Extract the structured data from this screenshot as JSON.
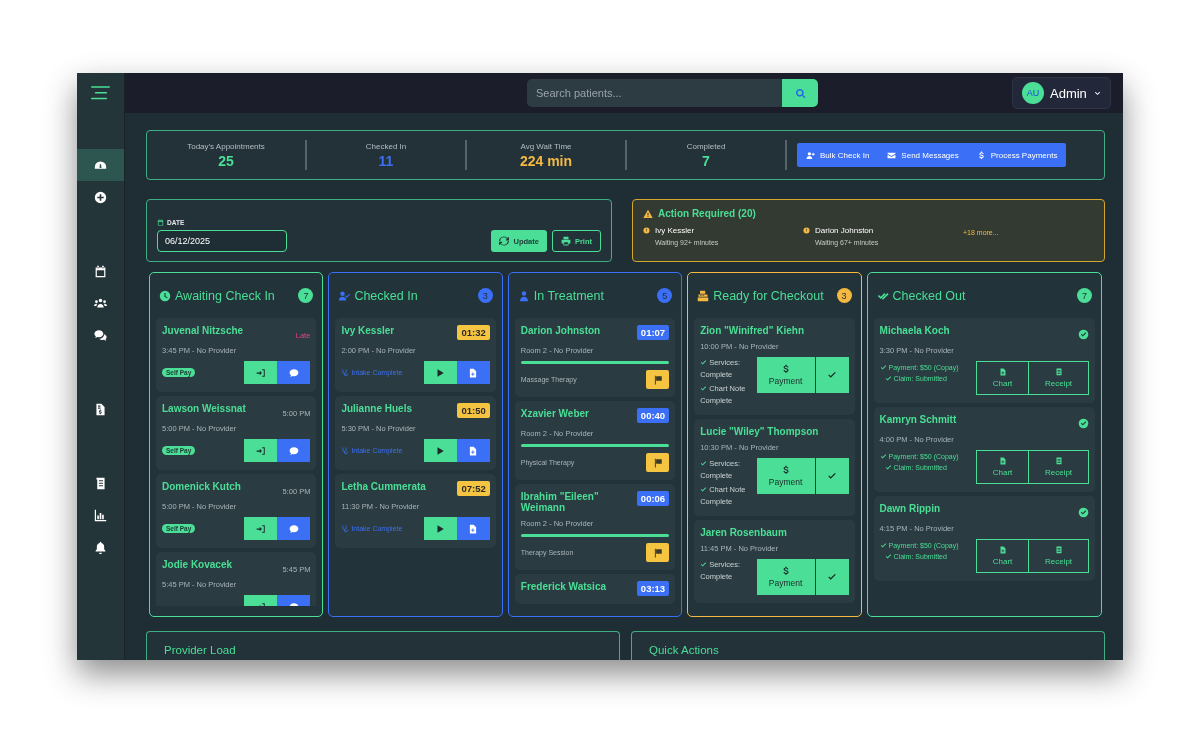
{
  "topbar": {
    "search": {
      "placeholder": "Search patients..."
    },
    "user": {
      "initials": "AU",
      "name": "Admin"
    }
  },
  "sidebar": {
    "groups": [
      [
        {
          "selected": true
        },
        {
          "selected": false
        }
      ],
      [
        {
          "selected": false
        },
        {
          "selected": false
        },
        {
          "selected": false
        }
      ],
      [
        {
          "selected": false
        }
      ],
      [
        {
          "selected": false
        },
        {
          "selected": false
        },
        {
          "selected": false
        }
      ]
    ]
  },
  "stats": [
    {
      "label": "Today's Appointments",
      "value": "25",
      "color": "#4ade96"
    },
    {
      "label": "Checked In",
      "value": "11",
      "color": "#3b6ff5"
    },
    {
      "label": "Avg Wait Time",
      "value": "224 min",
      "color": "#f5b942"
    },
    {
      "label": "Completed",
      "value": "7",
      "color": "#4ade96"
    }
  ],
  "bulk_actions": [
    "Bulk Check In",
    "Send Messages",
    "Process Payments"
  ],
  "date_filter": {
    "label": "DATE",
    "value": "06/12/2025",
    "buttons": [
      "Update",
      "Print"
    ]
  },
  "action_required": {
    "title": "Action Required (20)",
    "items": [
      {
        "name": "Ivy Kessler",
        "detail": "Waiting 92+ minutes"
      },
      {
        "name": "Darion Johnston",
        "detail": "Waiting 67+ minutes"
      }
    ],
    "more": "+18 more..."
  },
  "columns": [
    {
      "kind": "awaiting",
      "title": "Awaiting Check In",
      "count": "7",
      "color": "#4ade96",
      "cards": [
        {
          "name": "Juvenal Nitzsche",
          "note": "Late",
          "late": true,
          "sub": "3:45 PM - No Provider",
          "tag": "Self Pay"
        },
        {
          "name": "Lawson Weissnat",
          "note": "5:00 PM",
          "late": false,
          "sub": "5:00 PM - No Provider",
          "tag": "Self Pay"
        },
        {
          "name": "Domenick Kutch",
          "note": "5:00 PM",
          "late": false,
          "sub": "5:00 PM - No Provider",
          "tag": "Self Pay"
        },
        {
          "name": "Jodie Kovacek",
          "note": "5:45 PM",
          "late": false,
          "sub": "5:45 PM - No Provider"
        }
      ]
    },
    {
      "kind": "checked_in",
      "title": "Checked In",
      "count": "3",
      "color": "#3b6ff5",
      "cards": [
        {
          "name": "Ivy Kessler",
          "timer": "01:32",
          "sub": "2:00 PM - No Provider",
          "status": "Intake Complete"
        },
        {
          "name": "Julianne Huels",
          "timer": "01:50",
          "sub": "5:30 PM - No Provider",
          "status": "Intake Complete"
        },
        {
          "name": "Letha Cummerata",
          "timer": "07:52",
          "sub": "11:30 PM - No Provider",
          "status": "Intake Complete"
        }
      ]
    },
    {
      "kind": "treatment",
      "title": "In Treatment",
      "count": "5",
      "color": "#3b6ff5",
      "cards": [
        {
          "name": "Darion Johnston",
          "timer": "01:07",
          "sub": "Room 2 - No Provider",
          "level": 1,
          "therapy": "Massage Therapy"
        },
        {
          "name": "Xzavier Weber",
          "timer": "00:40",
          "sub": "Room 2 - No Provider",
          "level": 1,
          "therapy": "Physical Therapy"
        },
        {
          "name": "Ibrahim \"Eileen\" Weimann",
          "timer": "00:06",
          "sub": "Room 2 - No Provider",
          "level": 1,
          "therapy": "Therapy Session"
        },
        {
          "name": "Frederick Watsica",
          "timer": "03:13"
        }
      ]
    },
    {
      "kind": "checkout",
      "title": "Ready for Checkout",
      "count": "3",
      "color": "#f5b942",
      "cards": [
        {
          "name": "Zion \"Winifred\" Kiehn",
          "sub": "10:00 PM - No Provider",
          "notes": [
            "Services: Complete",
            "Chart Note Complete"
          ],
          "action": "Payment"
        },
        {
          "name": "Lucie \"Wiley\" Thompson",
          "sub": "10:30 PM - No Provider",
          "notes": [
            "Services: Complete",
            "Chart Note Complete"
          ],
          "action": "Payment"
        },
        {
          "name": "Jaren Rosenbaum",
          "sub": "11:45 PM - No Provider",
          "notes": [
            "Services: Complete"
          ],
          "action": "Payment"
        }
      ]
    },
    {
      "kind": "checked_out",
      "title": "Checked Out",
      "count": "7",
      "color": "#4ade96",
      "cards": [
        {
          "name": "Michaela Koch",
          "sub": "3:30 PM - No Provider",
          "notes": [
            "Payment: $50 (Copay)",
            "Claim: Submitted"
          ],
          "actions": [
            "Chart",
            "Receipt"
          ]
        },
        {
          "name": "Kamryn Schmitt",
          "sub": "4:00 PM - No Provider",
          "notes": [
            "Payment: $50 (Copay)",
            "Claim: Submitted"
          ],
          "actions": [
            "Chart",
            "Receipt"
          ]
        },
        {
          "name": "Dawn Rippin",
          "sub": "4:15 PM - No Provider",
          "notes": [
            "Payment: $50 (Copay)",
            "Claim: Submitted"
          ],
          "actions": [
            "Chart",
            "Receipt"
          ]
        }
      ]
    }
  ],
  "panels": [
    "Provider Load",
    "Quick Actions"
  ]
}
